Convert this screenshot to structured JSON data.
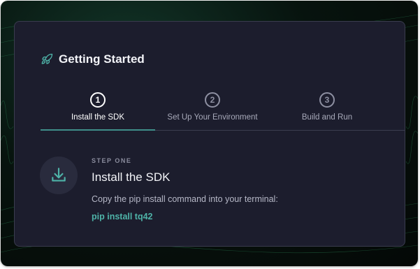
{
  "card": {
    "title": "Getting Started",
    "icon": "rocket-icon"
  },
  "tabs": [
    {
      "number": "1",
      "label": "Install the SDK",
      "active": true
    },
    {
      "number": "2",
      "label": "Set Up Your Environment",
      "active": false
    },
    {
      "number": "3",
      "label": "Build and Run",
      "active": false
    }
  ],
  "step": {
    "kicker": "STEP ONE",
    "title": "Install the SDK",
    "description": "Copy the pip install command into your terminal:",
    "command": "pip install tq42",
    "icon": "download-icon"
  },
  "colors": {
    "card_bg": "#1c1d2d",
    "accent": "#4eb3a8",
    "tab_underline": "#3f8f8a",
    "background": "#07130e"
  }
}
